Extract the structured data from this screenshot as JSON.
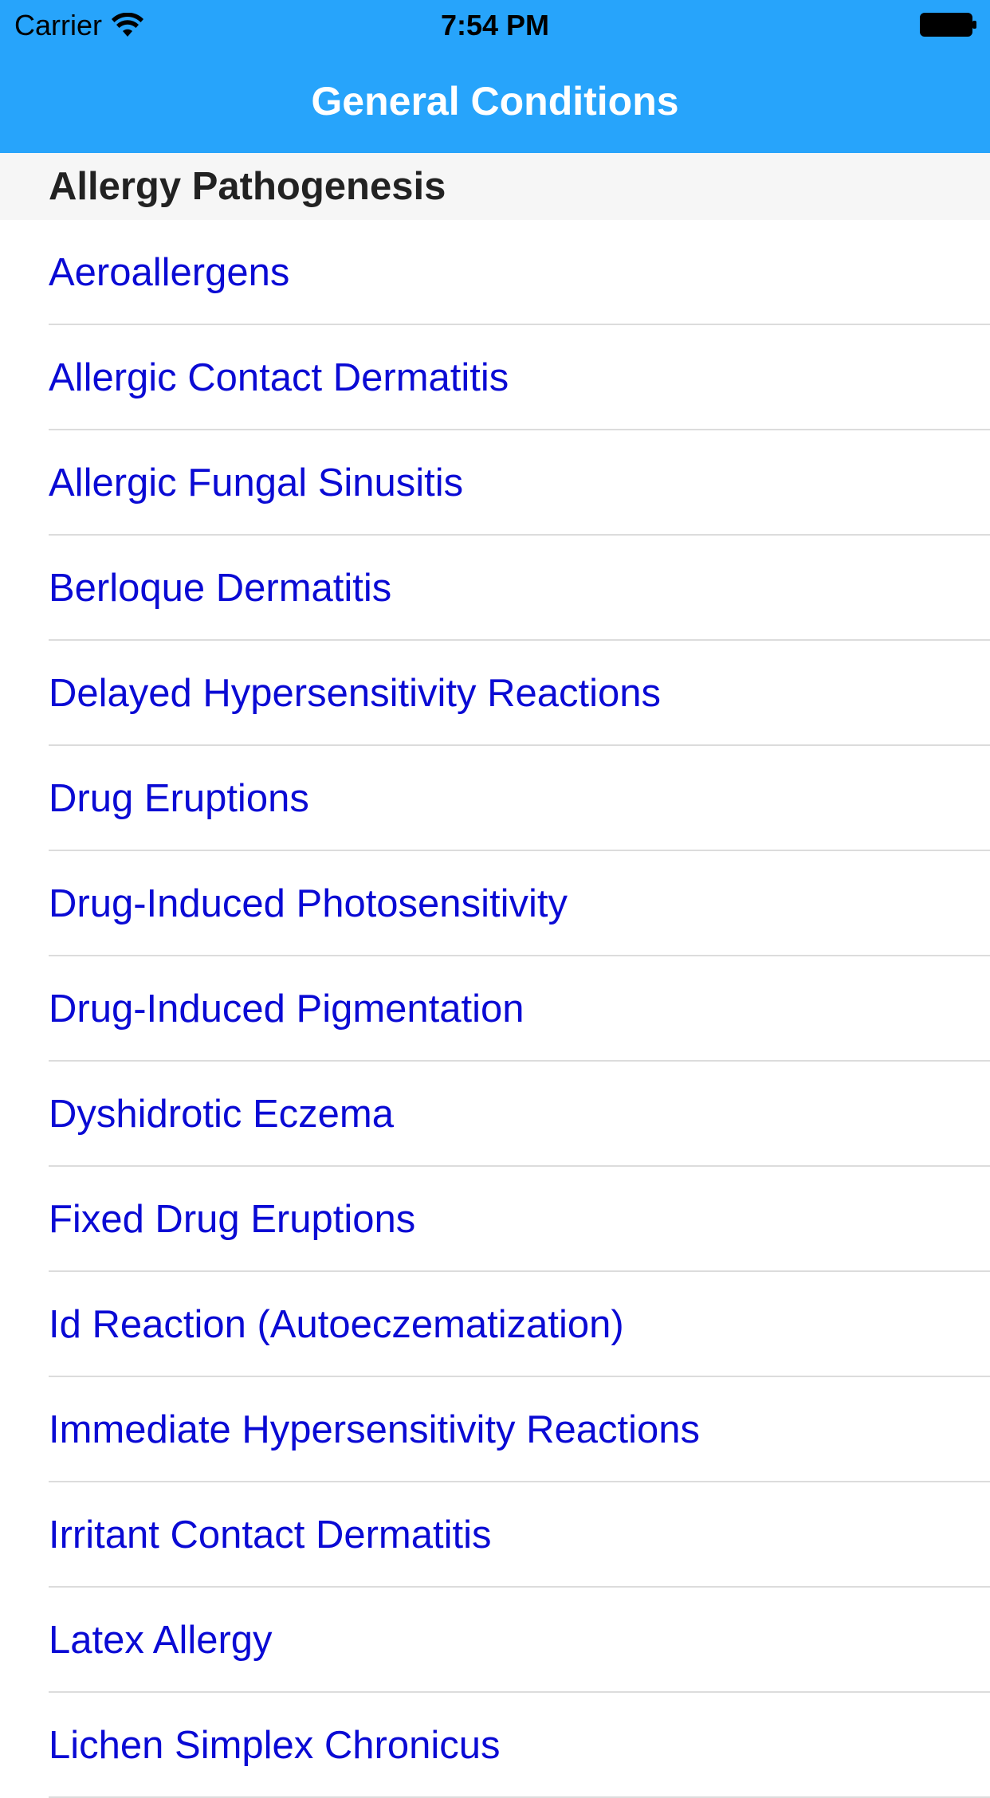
{
  "status_bar": {
    "carrier": "Carrier",
    "time": "7:54 PM",
    "wifi_icon": "wifi-icon",
    "battery_icon": "battery-icon"
  },
  "nav": {
    "title": "General Conditions",
    "background_color": "#27a4fb"
  },
  "section": {
    "title": "Allergy Pathogenesis"
  },
  "items": [
    "Aeroallergens",
    "Allergic Contact Dermatitis",
    "Allergic Fungal Sinusitis",
    "Berloque Dermatitis",
    "Delayed Hypersensitivity Reactions",
    "Drug Eruptions",
    "Drug-Induced Photosensitivity",
    "Drug-Induced Pigmentation",
    "Dyshidrotic Eczema",
    "Fixed Drug Eruptions",
    "Id Reaction (Autoeczematization)",
    "Immediate Hypersensitivity Reactions",
    "Irritant Contact Dermatitis",
    "Latex Allergy",
    "Lichen Simplex Chronicus"
  ],
  "colors": {
    "link": "#0a0ad4",
    "section_bg": "#f6f6f6",
    "separator": "#dcdcdc"
  }
}
